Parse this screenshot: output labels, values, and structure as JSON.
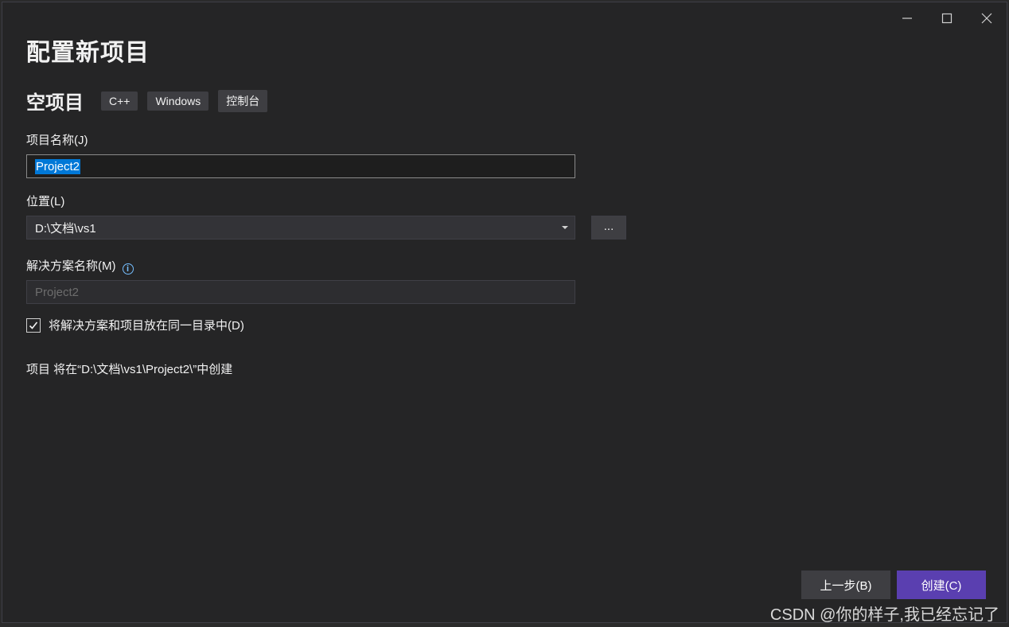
{
  "page": {
    "title": "配置新项目"
  },
  "template": {
    "name": "空项目",
    "tags": [
      "C++",
      "Windows",
      "控制台"
    ]
  },
  "form": {
    "project_name_label": "项目名称(J)",
    "project_name_value": "Project2",
    "location_label": "位置(L)",
    "location_value": "D:\\文档\\vs1",
    "browse_label": "...",
    "solution_name_label": "解决方案名称(M)",
    "solution_name_value": "Project2",
    "same_dir_checkbox_label": "将解决方案和项目放在同一目录中(D)",
    "same_dir_checked": true,
    "path_note": "项目 将在“D:\\文档\\vs1\\Project2\\”中创建"
  },
  "buttons": {
    "back_label": "上一步(B)",
    "create_label": "创建(C)"
  },
  "window_controls": {
    "minimize": "minimize-icon",
    "maximize": "maximize-icon",
    "close": "close-icon"
  },
  "watermark": "CSDN @你的样子,我已经忘记了",
  "colors": {
    "background": "#252526",
    "accent": "#5a3fb0",
    "selection": "#0078d7",
    "info": "#75beff"
  }
}
